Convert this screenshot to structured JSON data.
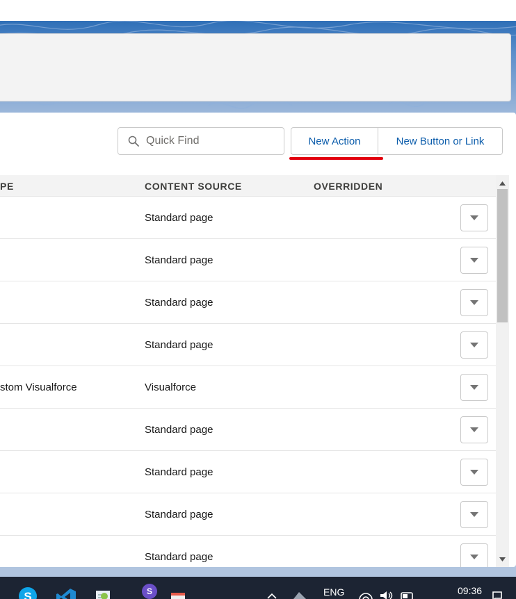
{
  "toolbar": {
    "quick_find_placeholder": "Quick Find",
    "new_action_label": "New Action",
    "new_button_link_label": "New Button or Link"
  },
  "table": {
    "columns": [
      "PE",
      "CONTENT SOURCE",
      "OVERRIDDEN"
    ],
    "rows": [
      {
        "type": "",
        "source": "Standard page",
        "overridden": ""
      },
      {
        "type": "",
        "source": "Standard page",
        "overridden": ""
      },
      {
        "type": "",
        "source": "Standard page",
        "overridden": ""
      },
      {
        "type": "",
        "source": "Standard page",
        "overridden": ""
      },
      {
        "type": "stom Visualforce",
        "source": "Visualforce",
        "overridden": ""
      },
      {
        "type": "",
        "source": "Standard page",
        "overridden": ""
      },
      {
        "type": "",
        "source": "Standard page",
        "overridden": ""
      },
      {
        "type": "",
        "source": "Standard page",
        "overridden": ""
      },
      {
        "type": "",
        "source": "Standard page",
        "overridden": ""
      }
    ]
  },
  "taskbar": {
    "language": "ENG",
    "time": "09:36",
    "badge_letter": "S"
  },
  "colors": {
    "link_blue": "#0b5cab",
    "highlight_red": "#e3000f",
    "brand_band": "#b0c4df",
    "taskbar": "#1c2433"
  },
  "icons": [
    "search-icon",
    "chevron-down-icon",
    "scroll-up-icon",
    "scroll-down-icon",
    "skype-icon",
    "vscode-icon",
    "notepad-icon",
    "app-badge-icon",
    "calendar-icon",
    "tray-chevron-icon",
    "network-icon",
    "wifi-icon",
    "volume-icon",
    "battery-icon",
    "notification-icon"
  ]
}
